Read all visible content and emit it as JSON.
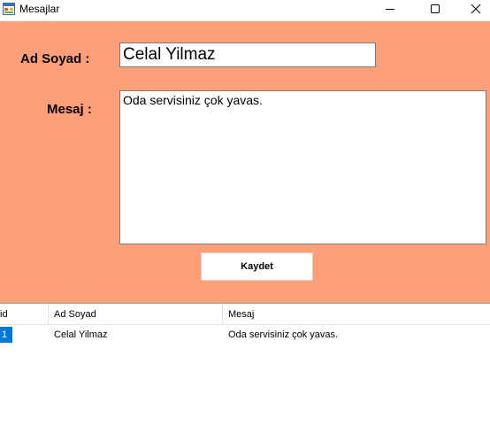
{
  "window": {
    "title": "Mesajlar"
  },
  "form": {
    "name_label": "Ad Soyad :",
    "name_value": "Celal Yilmaz",
    "message_label": "Mesaj :",
    "message_value": "Oda servisiniz çok yavas.",
    "save_label": "Kaydet"
  },
  "grid": {
    "columns": [
      "id",
      "Ad Soyad",
      "Mesaj"
    ],
    "rows": [
      {
        "id": "1",
        "name": "Celal Yilmaz",
        "message": "Oda servisiniz çok yavas."
      }
    ]
  },
  "colors": {
    "panel_background": "#ff9f7a",
    "selection": "#0078d7"
  },
  "icons": {
    "app": "app-window-icon",
    "minimize": "minimize-icon",
    "maximize": "maximize-icon",
    "close": "close-icon"
  }
}
